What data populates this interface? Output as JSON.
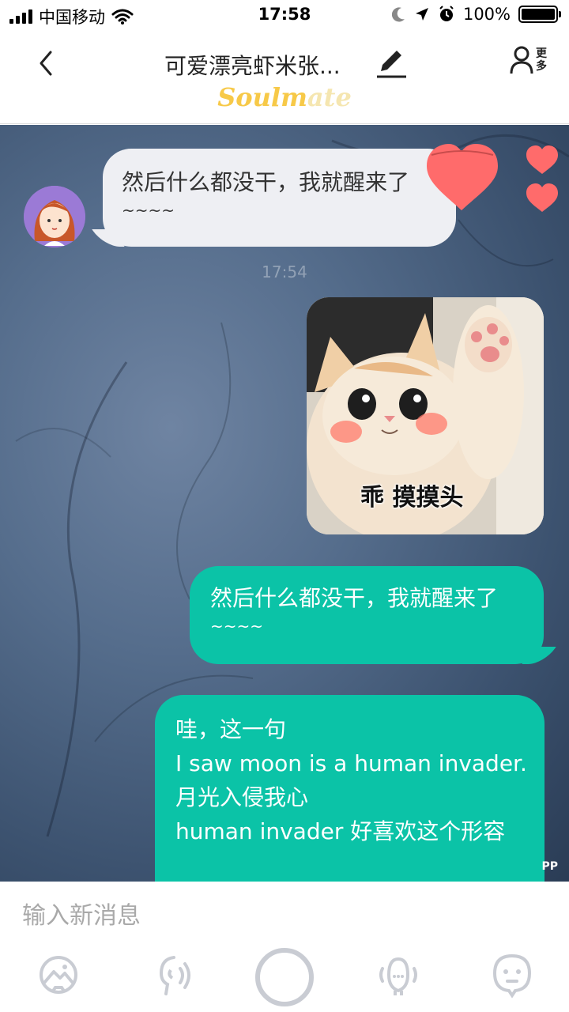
{
  "status_bar": {
    "carrier": "中国移动",
    "time": "17:58",
    "battery": "100%"
  },
  "header": {
    "title": "可爱漂亮虾米张...",
    "more_label": "更多",
    "brand_part1": "Soulm",
    "brand_part2": "ate"
  },
  "chat": {
    "messages": [
      {
        "text": "然后什么都没干，我就醒来了",
        "tail": "~~~~"
      },
      {
        "timestamp": "17:54"
      },
      {
        "sticker_caption": "乖 摸摸头"
      },
      {
        "text": "然后什么都没干，我就醒来了",
        "tail": "~~~~"
      },
      {
        "lines": [
          "哇，这一句",
          "I saw moon is a human invader.",
          "月光入侵我心",
          "human invader 好喜欢这个形容"
        ]
      }
    ],
    "watermark": "PP"
  },
  "input": {
    "placeholder": "输入新消息"
  },
  "toolbar": {
    "icons": [
      "photo-icon",
      "voice-face-icon",
      "record-button",
      "mask-icon",
      "emoji-icon"
    ]
  },
  "colors": {
    "accent": "#0bc3a7",
    "heart": "#ff6b6b",
    "brand_yellow": "#f7c948"
  }
}
